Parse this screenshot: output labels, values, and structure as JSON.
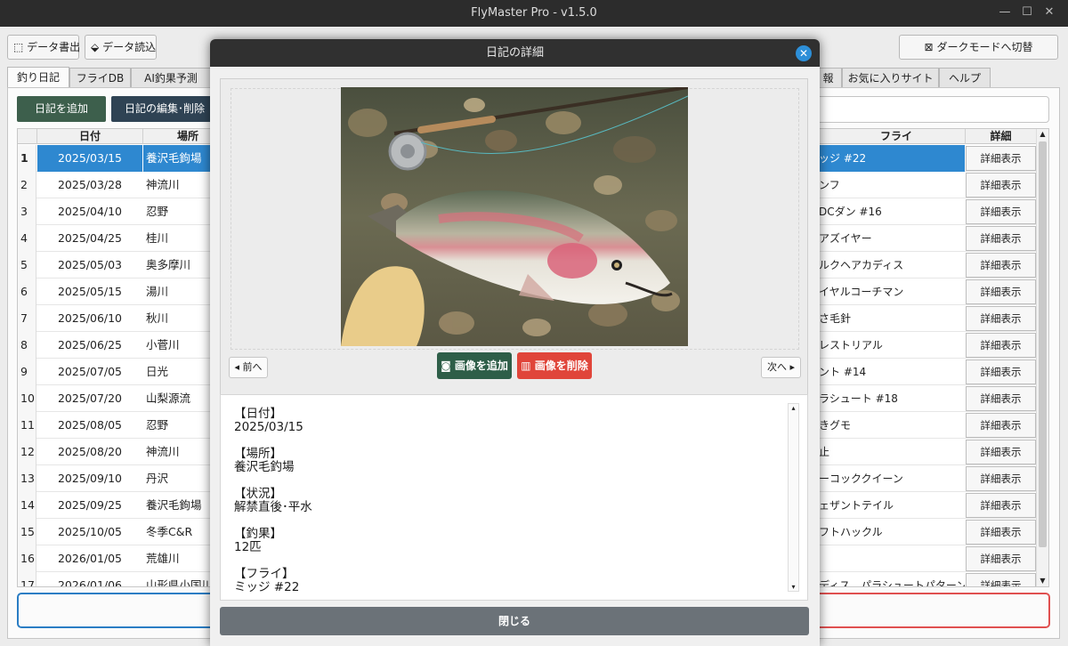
{
  "window": {
    "title": "FlyMaster Pro - v1.5.0"
  },
  "toolbar": {
    "export_label": "データ書出",
    "import_label": "データ読込",
    "dark_mode_label": "ダークモードへ切替"
  },
  "tabs": [
    "釣り日記",
    "フライDB",
    "AI釣果予測",
    "報",
    "お気に入りサイト",
    "ヘルプ"
  ],
  "actions": {
    "add_label": "日記を追加",
    "edit_label": "日記の編集･削除"
  },
  "table": {
    "headers": {
      "date": "日付",
      "place": "場所",
      "fly": "フライ",
      "detail": "詳細"
    },
    "detail_button": "詳細表示",
    "rows": [
      {
        "n": "1",
        "date": "2025/03/15",
        "place": "養沢毛鉤場",
        "fly": "ッジ #22"
      },
      {
        "n": "2",
        "date": "2025/03/28",
        "place": "神流川",
        "fly": "ンフ"
      },
      {
        "n": "3",
        "date": "2025/04/10",
        "place": "忍野",
        "fly": "DCダン #16"
      },
      {
        "n": "4",
        "date": "2025/04/25",
        "place": "桂川",
        "fly": "アズイヤー"
      },
      {
        "n": "5",
        "date": "2025/05/03",
        "place": "奥多摩川",
        "fly": "ルクヘアカディス"
      },
      {
        "n": "6",
        "date": "2025/05/15",
        "place": "湯川",
        "fly": "イヤルコーチマン"
      },
      {
        "n": "7",
        "date": "2025/06/10",
        "place": "秋川",
        "fly": "さ毛針"
      },
      {
        "n": "8",
        "date": "2025/06/25",
        "place": "小菅川",
        "fly": "レストリアル"
      },
      {
        "n": "9",
        "date": "2025/07/05",
        "place": "日光",
        "fly": "ント #14"
      },
      {
        "n": "10",
        "date": "2025/07/20",
        "place": "山梨源流",
        "fly": "ラシュート #18"
      },
      {
        "n": "11",
        "date": "2025/08/05",
        "place": "忍野",
        "fly": "きグモ"
      },
      {
        "n": "12",
        "date": "2025/08/20",
        "place": "神流川",
        "fly": "止"
      },
      {
        "n": "13",
        "date": "2025/09/10",
        "place": "丹沢",
        "fly": "ーコッククイーン"
      },
      {
        "n": "14",
        "date": "2025/09/25",
        "place": "養沢毛鉤場",
        "fly": "ェザントテイル"
      },
      {
        "n": "15",
        "date": "2025/10/05",
        "place": "冬季C&R",
        "fly": "フトハックル"
      },
      {
        "n": "16",
        "date": "2026/01/05",
        "place": "荒雄川",
        "fly": ""
      },
      {
        "n": "17",
        "date": "2026/01/06",
        "place": "山形県小国川水系",
        "fly": "ディス、パラシュートパターンが"
      }
    ]
  },
  "modal": {
    "title": "日記の詳細",
    "prev_label": "◂ 前へ",
    "next_label": "次へ ▸",
    "add_image_label": "画像を追加",
    "delete_image_label": "画像を削除",
    "close_label": "閉じる",
    "details": [
      {
        "label": "【日付】",
        "value": "2025/03/15"
      },
      {
        "label": "【場所】",
        "value": "養沢毛釣場"
      },
      {
        "label": "【状況】",
        "value": "解禁直後･平水"
      },
      {
        "label": "【釣果】",
        "value": "12匹"
      },
      {
        "label": "【フライ】",
        "value": "ミッジ #22"
      }
    ]
  },
  "colors": {
    "selected_row": "#2e88d0",
    "add_button": "#3d5f4c",
    "edit_button": "#2f4354",
    "image_add": "#2e5e48",
    "image_delete": "#e0453a",
    "close_button": "#6b7278",
    "modal_close": "#2d8fd8"
  }
}
